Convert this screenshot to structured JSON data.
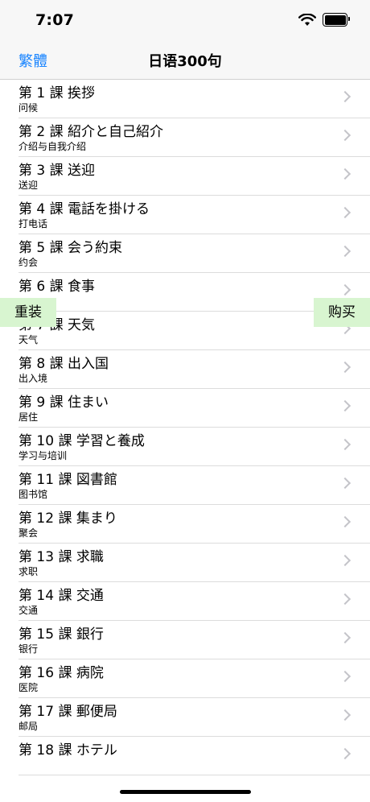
{
  "status_bar": {
    "time": "7:07"
  },
  "nav": {
    "left_button": "繁體",
    "title": "日语300句"
  },
  "floating": {
    "left_button": "重装",
    "right_button": "购买"
  },
  "lessons": [
    {
      "title": "第 1 課 挨拶",
      "subtitle": "问候"
    },
    {
      "title": "第 2 課 紹介と自己紹介",
      "subtitle": "介绍与自我介绍"
    },
    {
      "title": "第 3 課 送迎",
      "subtitle": "送迎"
    },
    {
      "title": "第 4 課 電話を掛ける",
      "subtitle": "打电话"
    },
    {
      "title": "第 5 課 会う約束",
      "subtitle": "约会"
    },
    {
      "title": "第 6 課 食事",
      "subtitle": ""
    },
    {
      "title": "第 7 課 天気",
      "subtitle": "天气"
    },
    {
      "title": "第 8 課 出入国",
      "subtitle": "出入境"
    },
    {
      "title": "第 9 課 住まい",
      "subtitle": "居住"
    },
    {
      "title": "第 10 課 学習と養成",
      "subtitle": "学习与培训"
    },
    {
      "title": "第 11 課 図書館",
      "subtitle": "图书馆"
    },
    {
      "title": "第 12 課 集まり",
      "subtitle": "聚会"
    },
    {
      "title": "第 13 課 求職",
      "subtitle": "求职"
    },
    {
      "title": "第 14 課 交通",
      "subtitle": "交通"
    },
    {
      "title": "第 15 課 銀行",
      "subtitle": "银行"
    },
    {
      "title": "第 16 課 病院",
      "subtitle": "医院"
    },
    {
      "title": "第 17 課 郵便局",
      "subtitle": "邮局"
    },
    {
      "title": "第 18 課 ホテル",
      "subtitle": ""
    }
  ]
}
